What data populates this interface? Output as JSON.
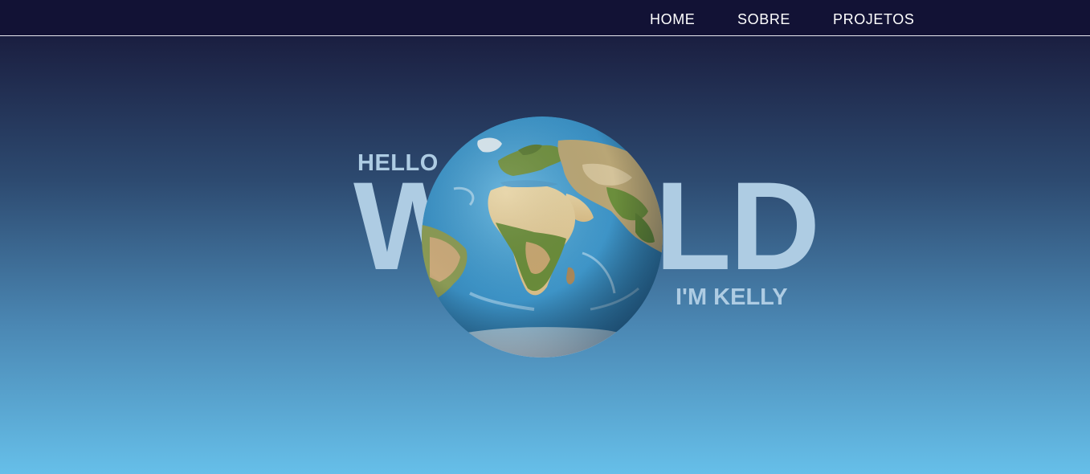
{
  "nav": {
    "items": [
      {
        "label": "HOME"
      },
      {
        "label": "SOBRE"
      },
      {
        "label": "PROJETOS"
      }
    ]
  },
  "hero": {
    "hello": "HELLO",
    "world": "WORLD",
    "subtitle": "I'M KELLY",
    "globe_icon": "earth-globe-icon"
  },
  "colors": {
    "nav_bg": "#121235",
    "gradient_top": "#1c2244",
    "gradient_bottom": "#66bfe9",
    "hero_text": "#aecce3",
    "nav_text": "#ffffff"
  }
}
